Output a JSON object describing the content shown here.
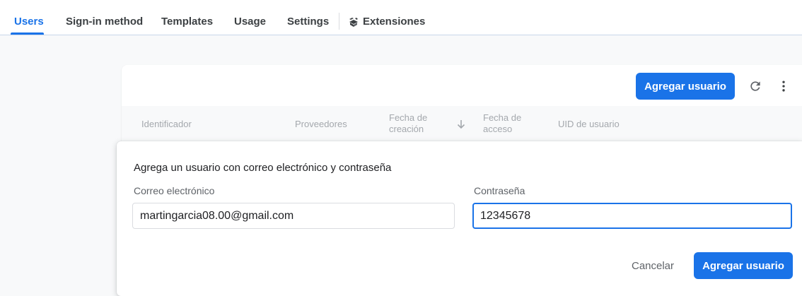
{
  "tabs": {
    "users": "Users",
    "sign_in": "Sign-in method",
    "templates": "Templates",
    "usage": "Usage",
    "settings": "Settings",
    "extensions": "Extensiones"
  },
  "toolbar": {
    "add_user_label": "Agregar usuario",
    "refresh_icon": "refresh-icon",
    "more_icon": "more-vert-icon"
  },
  "table": {
    "columns": {
      "identifier": "Identificador",
      "providers": "Proveedores",
      "created_line1": "Fecha de",
      "created_line2": "creación",
      "accessed_line1": "Fecha de",
      "accessed_line2": "acceso",
      "uid": "UID de usuario"
    },
    "sort_icon": "arrow-down-icon"
  },
  "dialog": {
    "title": "Agrega un usuario con correo electrónico y contraseña",
    "email_label": "Correo electrónico",
    "email_value": "martingarcia08.00@gmail.com",
    "password_label": "Contraseña",
    "password_value": "12345678",
    "cancel_label": "Cancelar",
    "submit_label": "Agregar usuario"
  },
  "colors": {
    "accent": "#1a73e8",
    "background": "#f8f9fa"
  }
}
